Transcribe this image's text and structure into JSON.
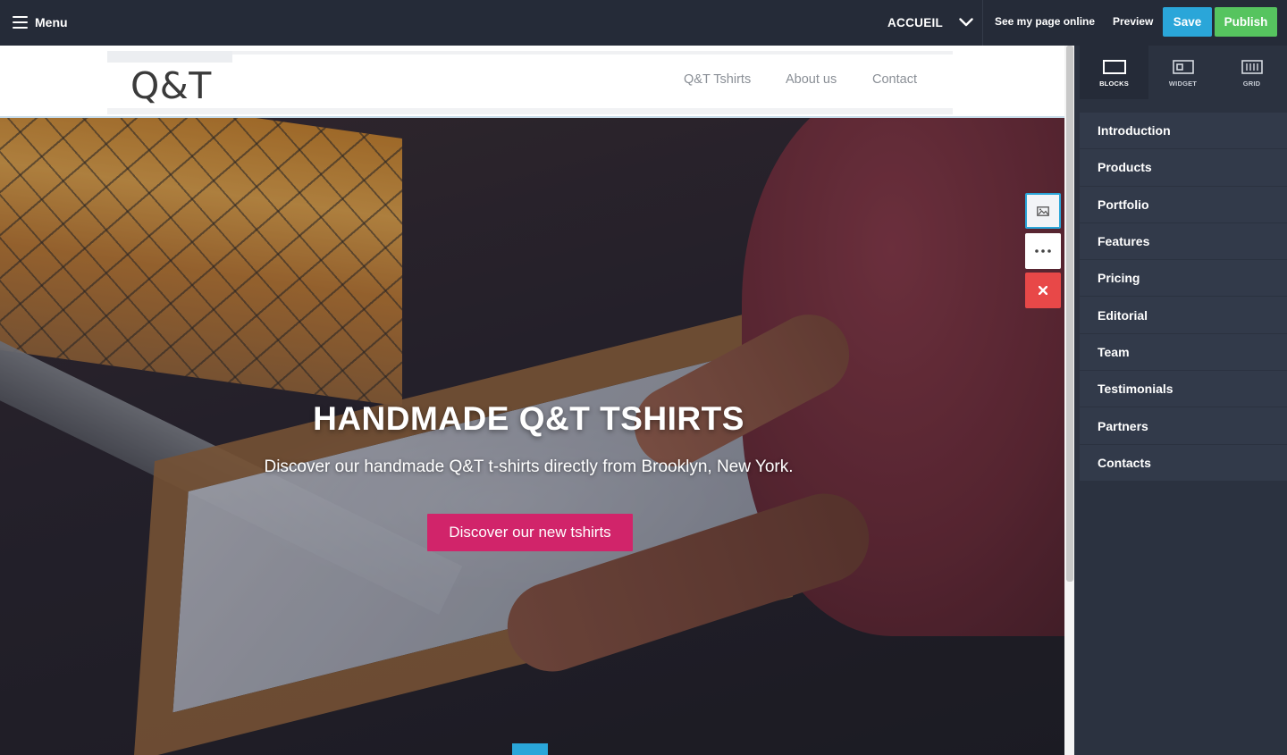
{
  "topbar": {
    "menu_label": "Menu",
    "page_select": "ACCUEIL",
    "see_online": "See my page online",
    "preview": "Preview",
    "save": "Save",
    "publish": "Publish",
    "colors": {
      "save": "#2aa6d9",
      "publish": "#56c45f",
      "background": "#252b38"
    }
  },
  "site": {
    "logo": "Q&T",
    "nav": [
      "Q&T Tshirts",
      "About us",
      "Contact"
    ],
    "hero": {
      "title": "HANDMADE Q&T TSHIRTS",
      "subtitle": "Discover our handmade Q&T t-shirts directly from Brooklyn, New York.",
      "cta": "Discover our new tshirts",
      "cta_color": "#d1246a"
    },
    "block_tools": [
      "image-icon",
      "more-icon",
      "close-icon"
    ]
  },
  "sidebar": {
    "tabs": [
      {
        "label": "BLOCKS",
        "icon": "blocks-icon",
        "active": true
      },
      {
        "label": "WIDGET",
        "icon": "widget-icon",
        "active": false
      },
      {
        "label": "GRID",
        "icon": "grid-icon",
        "active": false
      }
    ],
    "items": [
      "Introduction",
      "Products",
      "Portfolio",
      "Features",
      "Pricing",
      "Editorial",
      "Team",
      "Testimonials",
      "Partners",
      "Contacts"
    ]
  }
}
